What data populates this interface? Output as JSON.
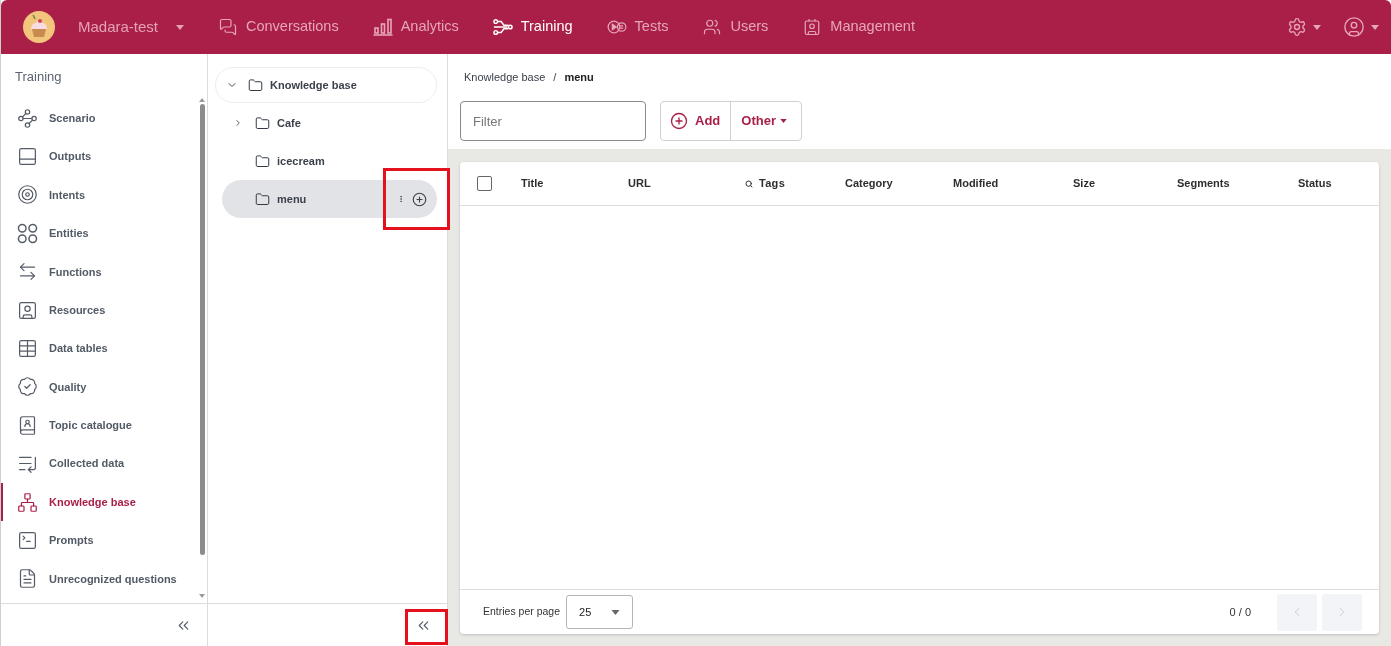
{
  "top_bar": {
    "workspace": "Madara-test",
    "nav": [
      {
        "label": "Conversations",
        "selected": false
      },
      {
        "label": "Analytics",
        "selected": false
      },
      {
        "label": "Training",
        "selected": true
      },
      {
        "label": "Tests",
        "selected": false
      },
      {
        "label": "Users",
        "selected": false
      },
      {
        "label": "Management",
        "selected": false
      }
    ]
  },
  "sidebar": {
    "title": "Training",
    "items": [
      {
        "label": "Scenario",
        "selected": false
      },
      {
        "label": "Outputs",
        "selected": false
      },
      {
        "label": "Intents",
        "selected": false
      },
      {
        "label": "Entities",
        "selected": false
      },
      {
        "label": "Functions",
        "selected": false
      },
      {
        "label": "Resources",
        "selected": false
      },
      {
        "label": "Data tables",
        "selected": false
      },
      {
        "label": "Quality",
        "selected": false
      },
      {
        "label": "Topic catalogue",
        "selected": false
      },
      {
        "label": "Collected data",
        "selected": false
      },
      {
        "label": "Knowledge base",
        "selected": true
      },
      {
        "label": "Prompts",
        "selected": false
      },
      {
        "label": "Unrecognized questions",
        "selected": false
      }
    ]
  },
  "tree": {
    "label": "Knowledge base",
    "expanded": true,
    "children": [
      {
        "label": "Cafe",
        "expanded": false,
        "selected": false,
        "highlighted": false
      },
      {
        "label": "icecream",
        "selected": false,
        "highlighted": false
      },
      {
        "label": "menu",
        "selected": true,
        "highlighted": true
      }
    ],
    "collapse_highlighted": true
  },
  "breadcrumb": {
    "items": [
      "Knowledge base",
      "menu"
    ],
    "separator": "/"
  },
  "toolbar": {
    "filter": {
      "placeholder": "Filter"
    },
    "add_label": "Add",
    "other_label": "Other"
  },
  "table": {
    "select_all": {
      "checked": false
    },
    "columns": [
      {
        "label": "Title",
        "search": false
      },
      {
        "label": "URL",
        "search": false
      },
      {
        "label": "Tags",
        "search": true
      },
      {
        "label": "Category",
        "search": false
      },
      {
        "label": "Modified",
        "search": false
      },
      {
        "label": "Size",
        "search": false
      },
      {
        "label": "Segments",
        "search": false
      },
      {
        "label": "Status",
        "search": false
      }
    ],
    "footer": {
      "entries_label": "Entries per page",
      "page_size": "25",
      "page_info": "0 / 0",
      "prev_disabled": true,
      "next_disabled": true
    }
  }
}
